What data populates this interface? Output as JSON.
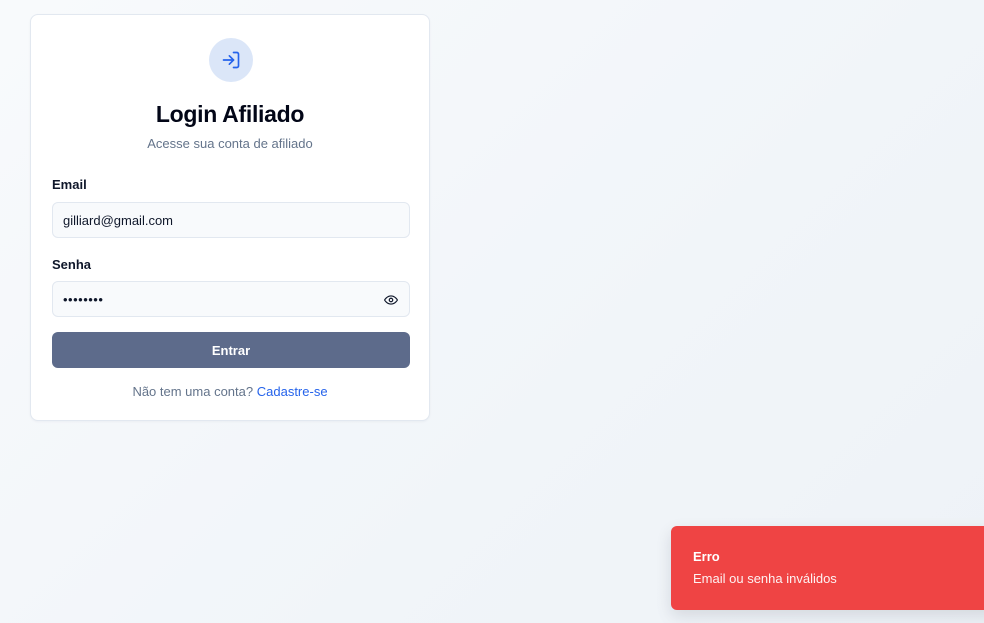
{
  "login": {
    "title": "Login Afiliado",
    "subtitle": "Acesse sua conta de afiliado",
    "icon": "log-in-icon",
    "email": {
      "label": "Email",
      "value": "gilliard@gmail.com"
    },
    "password": {
      "label": "Senha",
      "value_masked": "••••••••",
      "toggle_icon": "eye-icon"
    },
    "submit_label": "Entrar",
    "footer": {
      "prompt": "Não tem uma conta?",
      "link_label": "Cadastre-se"
    }
  },
  "toast": {
    "title": "Erro",
    "message": "Email ou senha inválidos"
  },
  "colors": {
    "accent": "#2563eb",
    "submit_button": "#5d6b8b",
    "toast_error": "#ef4444",
    "icon_circle": "#dbe6f8"
  }
}
